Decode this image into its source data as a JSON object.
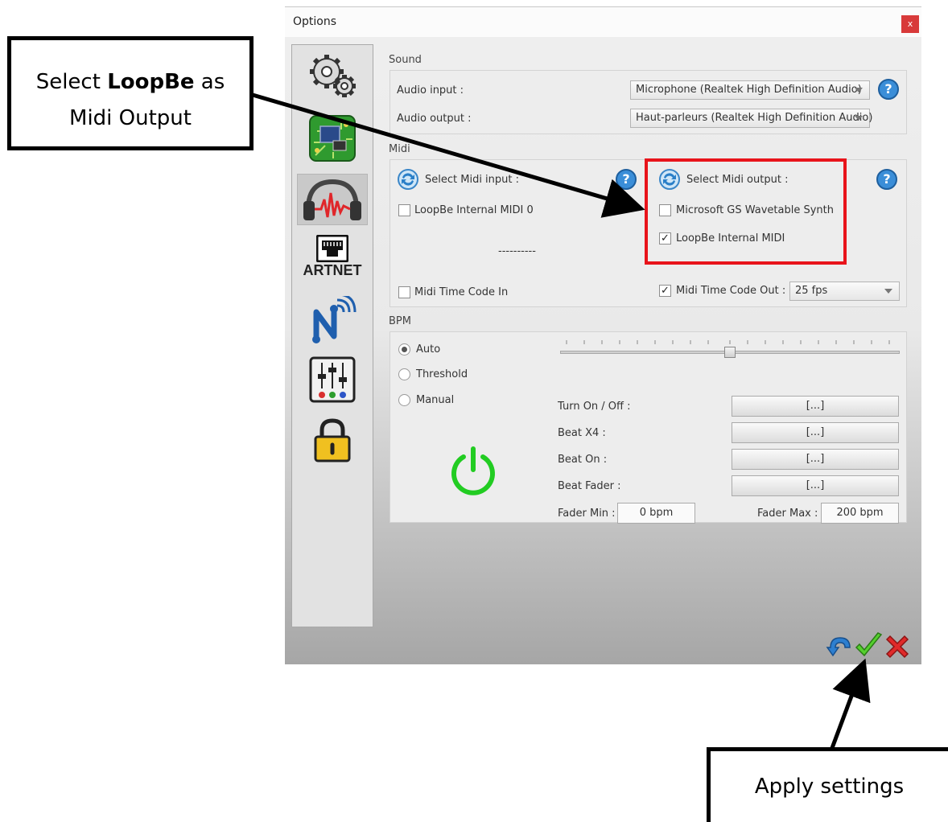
{
  "dialog": {
    "title": "Options",
    "close_label": "x"
  },
  "sidebar": {
    "items": [
      {
        "name": "settings",
        "icon": "gears-icon"
      },
      {
        "name": "hardware",
        "icon": "circuit-board-icon"
      },
      {
        "name": "sound",
        "icon": "headphones-icon"
      },
      {
        "name": "artnet",
        "icon": "ethernet-port-icon",
        "label": "ARTNET"
      },
      {
        "name": "network",
        "icon": "wireless-n-icon"
      },
      {
        "name": "mixer",
        "icon": "fader-mixer-icon"
      },
      {
        "name": "lock",
        "icon": "padlock-icon"
      }
    ],
    "active": "sound"
  },
  "sound": {
    "section_label": "Sound",
    "audio_input_label": "Audio input :",
    "audio_input_value": "Microphone (Realtek High Definition Audio)",
    "audio_output_label": "Audio output :",
    "audio_output_value": "Haut-parleurs (Realtek High Definition Audio)"
  },
  "midi": {
    "section_label": "Midi",
    "select_input_label": "Select Midi input :",
    "inputs": [
      {
        "label": "LoopBe Internal MIDI 0",
        "checked": false
      }
    ],
    "input_separator": "----------",
    "select_output_label": "Select Midi output :",
    "outputs": [
      {
        "label": "Microsoft GS Wavetable Synth",
        "checked": false
      },
      {
        "label": "LoopBe Internal MIDI",
        "checked": true
      }
    ],
    "time_code_in_label": "Midi Time Code In",
    "time_code_in_checked": false,
    "time_code_out_label": "Midi Time Code Out :",
    "time_code_out_checked": true,
    "fps_value": "25 fps",
    "highlight_color": "#e8141b"
  },
  "bpm": {
    "section_label": "BPM",
    "modes": [
      {
        "label": "Auto",
        "selected": true
      },
      {
        "label": "Threshold",
        "selected": false
      },
      {
        "label": "Manual",
        "selected": false
      }
    ],
    "slider_level": 0.5,
    "turn_on_off_label": "Turn On / Off :",
    "beat_x4_label": "Beat X4 :",
    "beat_on_label": "Beat On :",
    "beat_fader_label": "Beat Fader :",
    "assign_button_label": "[...]",
    "fader_min_label": "Fader Min :",
    "fader_min_value": "0  bpm",
    "fader_max_label": "Fader Max :",
    "fader_max_value": "200 bpm",
    "power_color": "#22cc22"
  },
  "footer": {
    "reset_icon": "undo-arrow-icon",
    "apply_icon": "checkmark-icon",
    "cancel_icon": "red-x-icon"
  },
  "annotations": {
    "callout_select_prefix": "Select ",
    "callout_select_bold": "LoopBe",
    "callout_select_suffix": " as",
    "callout_select_line2": "Midi Output",
    "callout_apply": "Apply settings"
  }
}
